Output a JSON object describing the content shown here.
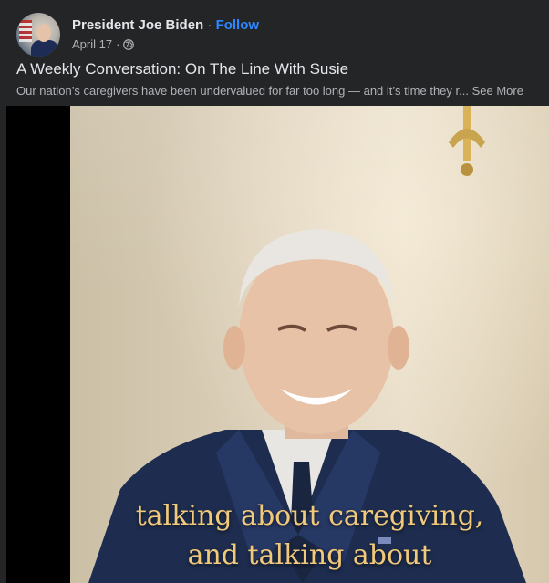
{
  "post": {
    "author": "President Joe Biden",
    "separator": "·",
    "follow_label": "Follow",
    "date": "April 17",
    "meta_separator": "·",
    "privacy_icon": "globe-icon",
    "title": "A Weekly Conversation: On The Line With Susie",
    "description": "Our nation’s caregivers have been undervalued for far too long — and it’s time they r...",
    "see_more_label": "See More"
  },
  "video": {
    "caption_line1": "talking about caregiving,",
    "caption_line2": "and talking about"
  },
  "colors": {
    "background": "#242526",
    "link": "#2d88ff",
    "caption": "#f0c97a"
  }
}
